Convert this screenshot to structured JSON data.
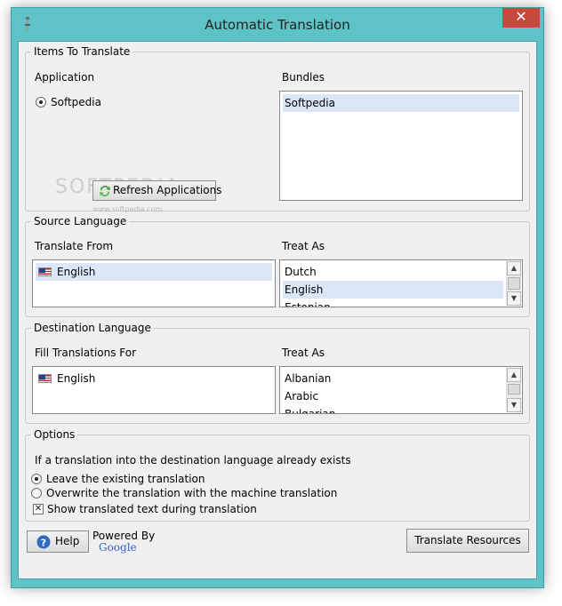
{
  "window": {
    "title": "Automatic Translation",
    "close_glyph": "✕"
  },
  "items_to_translate": {
    "legend": "Items To Translate",
    "application_label": "Application",
    "application_option": "Softpedia",
    "bundles_label": "Bundles",
    "bundles": [
      "Softpedia"
    ],
    "refresh_button": "Refresh Applications"
  },
  "source_language": {
    "legend": "Source Language",
    "translate_from_label": "Translate From",
    "translate_from_items": [
      "English"
    ],
    "treat_as_label": "Treat As",
    "treat_as_items": [
      "Dutch",
      "English",
      "Estonian"
    ]
  },
  "destination_language": {
    "legend": "Destination Language",
    "fill_label": "Fill Translations For",
    "fill_items": [
      "English"
    ],
    "treat_as_label": "Treat As",
    "treat_as_items": [
      "Albanian",
      "Arabic",
      "Bulgarian"
    ]
  },
  "options": {
    "legend": "Options",
    "question": "If a translation into the destination language already exists",
    "radio_leave": "Leave the existing translation",
    "radio_overwrite": "Overwrite the translation with the machine translation",
    "checkbox_show": "Show translated text during translation"
  },
  "footer": {
    "help_button": "Help",
    "powered_by": "Powered By",
    "google": "Google",
    "translate_button": "Translate Resources"
  },
  "watermark": {
    "text": "SOFTPEDIA",
    "url": "www.softpedia.com"
  }
}
